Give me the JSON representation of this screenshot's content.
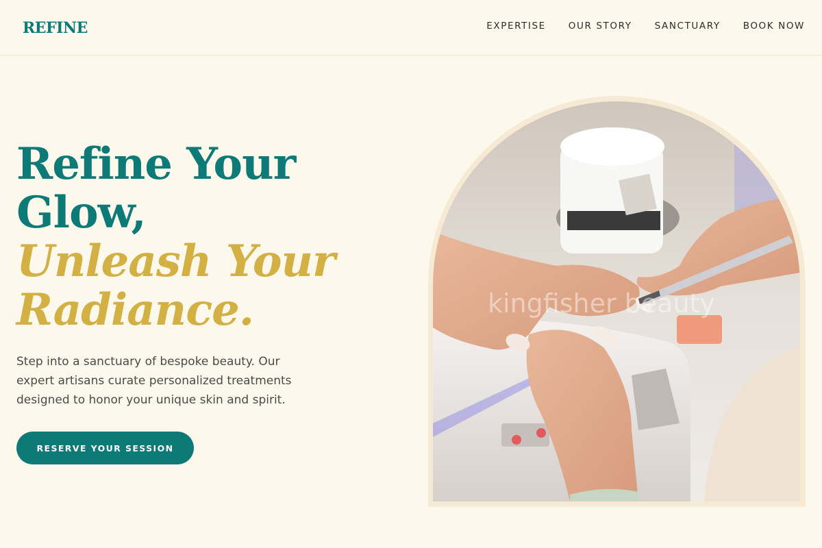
{
  "header": {
    "logo": "REFINE",
    "nav": [
      {
        "label": "EXPERTISE"
      },
      {
        "label": "OUR STORY"
      },
      {
        "label": "SANCTUARY"
      },
      {
        "label": "BOOK NOW"
      }
    ]
  },
  "hero": {
    "title_line1": "Refine Your",
    "title_line2": "Glow,",
    "title_line3": "Unleash Your",
    "title_line4": "Radiance.",
    "description": "Step into a sanctuary of bespoke beauty. Our expert artisans curate personalized treatments designed to honor your unique skin and spirit.",
    "cta_label": "RESERVE YOUR SESSION",
    "image_watermark": "kingfisher beauty"
  },
  "colors": {
    "background": "#fdf8ec",
    "teal": "#0d7a78",
    "gold": "#d2b043",
    "arch_frame": "#f6ead4"
  }
}
